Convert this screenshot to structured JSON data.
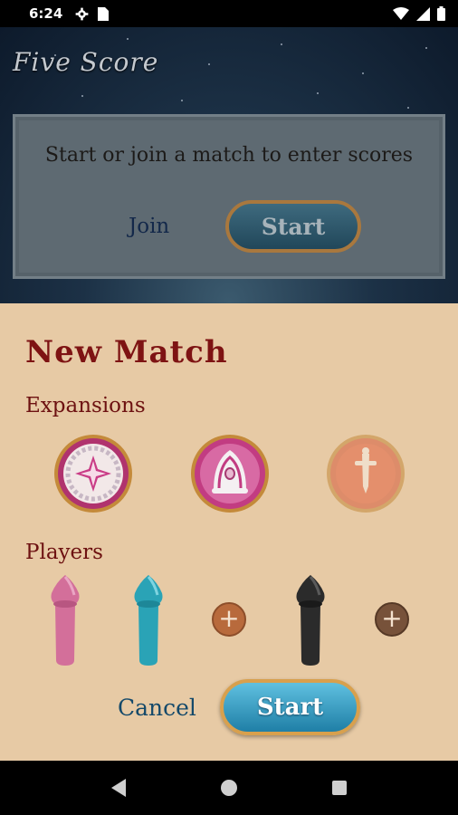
{
  "status_bar": {
    "time": "6:24",
    "left_icons": [
      "gear-icon",
      "sim-card-icon"
    ],
    "right_icons": [
      "wifi-icon",
      "signal-icon",
      "battery-icon"
    ]
  },
  "app": {
    "logo": "Five Score",
    "colors": {
      "title_red": "#7e1313",
      "sheet_bg": "#e7caa5",
      "start_blue": "#3a9fc8",
      "gold_border": "#d8a04d"
    }
  },
  "score_panel": {
    "message": "Start or join a match to enter scores",
    "join_label": "Join",
    "start_label": "Start"
  },
  "new_match": {
    "title": "New Match",
    "expansions_label": "Expansions",
    "expansions": [
      {
        "icon": "compass-star-icon",
        "selected": true
      },
      {
        "icon": "turban-icon",
        "selected": true
      },
      {
        "icon": "dagger-icon",
        "selected": false
      }
    ],
    "players_label": "Players",
    "players": [
      {
        "icon": "pawn-icon",
        "color": "#d36f9a"
      },
      {
        "icon": "pawn-icon",
        "color": "#2aa3b6"
      },
      {
        "icon": "pawn-icon",
        "color": "#2b2b2b"
      }
    ],
    "add_icon": "plus-icon",
    "cancel_label": "Cancel",
    "start_label": "Start"
  },
  "nav_bar": {
    "items": [
      "back-icon",
      "home-icon",
      "recents-icon"
    ]
  }
}
